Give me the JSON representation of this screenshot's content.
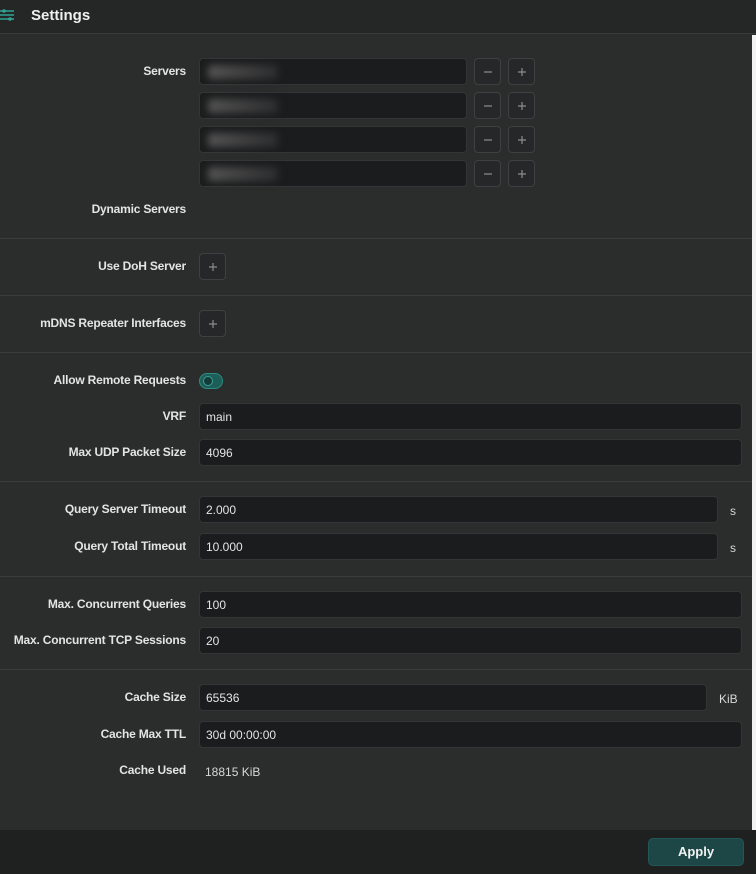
{
  "header": {
    "title": "Settings",
    "icon": "network-settings-icon"
  },
  "servers": {
    "label": "Servers",
    "rows": [
      "",
      "",
      "",
      ""
    ]
  },
  "dynamic_servers": {
    "label": "Dynamic Servers"
  },
  "doh": {
    "label": "Use DoH Server"
  },
  "mdns": {
    "label": "mDNS Repeater Interfaces"
  },
  "remote": {
    "label": "Allow Remote Requests",
    "enabled": true
  },
  "vrf": {
    "label": "VRF",
    "value": "main"
  },
  "max_udp": {
    "label": "Max UDP Packet Size",
    "value": "4096"
  },
  "query_server_timeout": {
    "label": "Query Server Timeout",
    "value": "2.000",
    "unit": "s"
  },
  "query_total_timeout": {
    "label": "Query Total Timeout",
    "value": "10.000",
    "unit": "s"
  },
  "max_queries": {
    "label": "Max. Concurrent Queries",
    "value": "100"
  },
  "max_tcp": {
    "label": "Max. Concurrent TCP Sessions",
    "value": "20"
  },
  "cache_size": {
    "label": "Cache Size",
    "value": "65536",
    "unit": "KiB"
  },
  "cache_ttl": {
    "label": "Cache Max TTL",
    "value": "30d 00:00:00"
  },
  "cache_used": {
    "label": "Cache Used",
    "value": "18815 KiB"
  },
  "footer": {
    "apply_label": "Apply"
  },
  "colors": {
    "accent": "#1d5e58",
    "background": "#2b2c2c",
    "input_bg": "#1b1c1d"
  }
}
